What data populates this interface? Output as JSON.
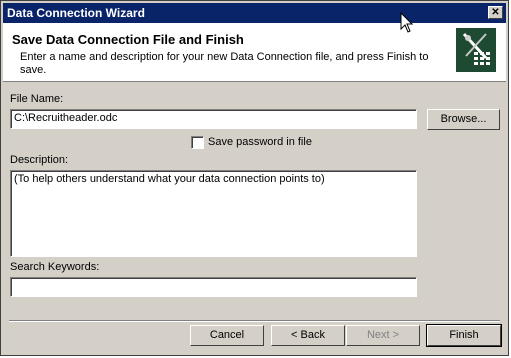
{
  "window": {
    "title": "Data Connection Wizard",
    "close_glyph": "✕"
  },
  "header": {
    "title": "Save Data Connection File and Finish",
    "description": "Enter a name and description for your new Data Connection file, and press Finish to save.",
    "icon": "data-connection-wizard-icon"
  },
  "form": {
    "file_name_label": "File Name:",
    "file_name_value": "C:\\Recruitheader.odc",
    "browse_label": "Browse...",
    "save_password_label": "Save password in file",
    "save_password_checked": false,
    "description_label": "Description:",
    "description_value": "(To help others understand what your data connection points to)",
    "search_keywords_label": "Search Keywords:",
    "search_keywords_value": ""
  },
  "footer": {
    "cancel_label": "Cancel",
    "back_label": "< Back",
    "next_label": "Next >",
    "finish_label": "Finish"
  },
  "colors": {
    "titlebar": "#0a246a",
    "dialog_bg": "#d4d0c8",
    "icon_bg": "#1e4a32"
  }
}
